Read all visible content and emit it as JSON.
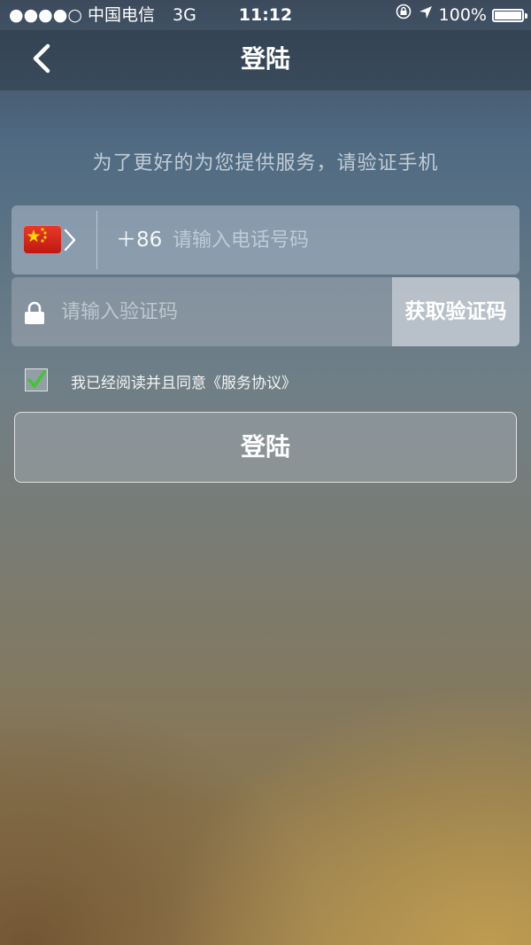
{
  "status_bar": {
    "signal_dots": "●●●●○",
    "carrier": "中国电信",
    "network": "3G",
    "time": "11:12",
    "battery": "100%",
    "icons": [
      "rotation-lock-icon",
      "location-arrow-icon",
      "battery-icon"
    ]
  },
  "nav": {
    "title": "登陆",
    "back_icon": "chevron-left-icon"
  },
  "hint": "为了更好的为您提供服务，请验证手机",
  "phone": {
    "country_flag": "china-flag-icon",
    "country_code": "＋86",
    "placeholder": "请输入电话号码",
    "value": ""
  },
  "code": {
    "lock_icon": "lock-icon",
    "placeholder": "请输入验证码",
    "value": "",
    "get_code_label": "获取验证码"
  },
  "agreement": {
    "checked": true,
    "text": "我已经阅读并且同意《服务协议》"
  },
  "login_button": "登陆",
  "colors": {
    "check_green": "#3ec82a",
    "flag_red": "#d8281a",
    "flag_star": "#ffd700"
  }
}
